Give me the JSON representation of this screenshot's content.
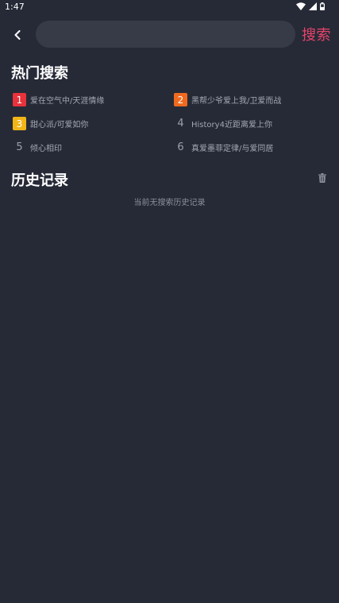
{
  "status_bar": {
    "time": "1:47",
    "icons": [
      "wifi-icon",
      "signal-icon",
      "battery-icon"
    ]
  },
  "search_bar": {
    "back_icon": "chevron-left-icon",
    "input_value": "",
    "input_placeholder": "",
    "submit_label": "搜索"
  },
  "hot_search": {
    "title": "热门搜索",
    "items": [
      {
        "rank": "1",
        "label": "爱在空气中/天涯情缘",
        "badge_color": "#e8323c",
        "style": "badge"
      },
      {
        "rank": "2",
        "label": "黑帮少爷爱上我/卫爱而战",
        "badge_color": "#ef6a1e",
        "style": "badge"
      },
      {
        "rank": "3",
        "label": "甜心派/可爱如你",
        "badge_color": "#f1b518",
        "style": "badge"
      },
      {
        "rank": "4",
        "label": "History4近距离爱上你",
        "badge_color": "",
        "style": "plain"
      },
      {
        "rank": "5",
        "label": "倾心相印",
        "badge_color": "",
        "style": "plain"
      },
      {
        "rank": "6",
        "label": "真爱墨菲定律/与爱同居",
        "badge_color": "",
        "style": "plain"
      }
    ]
  },
  "history": {
    "title": "历史记录",
    "clear_icon": "trash-icon",
    "empty_text": "当前无搜索历史记录"
  },
  "colors": {
    "background": "#262a37",
    "input_background": "#373b48",
    "accent": "#e9436a"
  }
}
